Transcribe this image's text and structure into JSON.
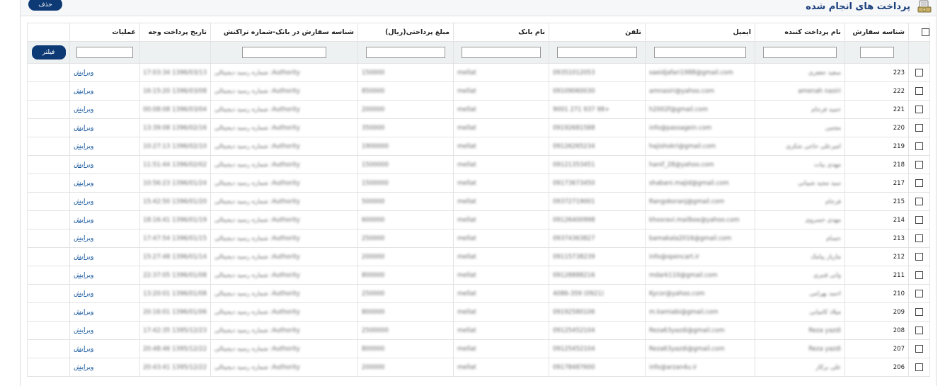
{
  "header": {
    "title": "پرداخت های انجام شده",
    "delete_label": "حذف"
  },
  "columns": {
    "id": "شناسه سفارش",
    "payer": "نام پرداخت کننده",
    "email": "ایمیل",
    "tel": "تلفن",
    "bank": "نام بانک",
    "amount": "مبلغ پرداختی(ریال)",
    "order": "شناسه سفارش در بانک-شماره تراکنش",
    "date": "تاریخ پرداخت وجه",
    "ops": "عملیات"
  },
  "filter": {
    "button_label": "فیلتر"
  },
  "rows": [
    {
      "id": "223",
      "payer": "سعید جعفری",
      "email": "saeidjafari1988@gmail.com",
      "tel": "09351012053",
      "bank": "mellat",
      "amount": "150000",
      "order": "Authority: شماره رسید دیجیتالی",
      "date": "1396/03/13 17:03:34",
      "op": "ویرایش"
    },
    {
      "id": "222",
      "payer": "amenah nasiri",
      "email": "amnasiri@yahoo.com",
      "tel": "09109060030",
      "bank": "mellat",
      "amount": "850000",
      "order": "Authority: شماره رسید دیجیتالی",
      "date": "1396/03/08 16:15:20",
      "op": "ویرایش"
    },
    {
      "id": "221",
      "payer": "حمید فرجام",
      "email": "h2002f@gmail.com",
      "tel": "+98 937 271 9001",
      "bank": "mellat",
      "amount": "200000",
      "order": "Authority: شماره رسید دیجیتالی",
      "date": "1396/03/04 00:08:08",
      "op": "ویرایش"
    },
    {
      "id": "220",
      "payer": "مجتبی",
      "email": "info@passagein.com",
      "tel": "09192681588",
      "bank": "mellat",
      "amount": "350000",
      "order": "Authority: شماره رسید دیجیتالی",
      "date": "1396/02/16 13:39:08",
      "op": "ویرایش"
    },
    {
      "id": "219",
      "payer": "امیرعلی حاجی شکری",
      "email": "hajishokri@gmail.com",
      "tel": "09126265234",
      "bank": "mellat",
      "amount": "1900000",
      "order": "Authority: شماره رسید دیجیتالی",
      "date": "1396/02/10 10:27:13",
      "op": "ویرایش"
    },
    {
      "id": "218",
      "payer": "مهدی بیات",
      "email": "hanif_28@yahoo.com",
      "tel": "09121353451",
      "bank": "mellat",
      "amount": "1500000",
      "order": "Authority: شماره رسید دیجیتالی",
      "date": "1396/02/02 11:51:44",
      "op": "ویرایش"
    },
    {
      "id": "217",
      "payer": "سید مجید شیبانی",
      "email": "shabani.majid@gmail.com",
      "tel": "09173673450",
      "bank": "mellat",
      "amount": "1500000",
      "order": "Authority: شماره رسید دیجیتالی",
      "date": "1396/01/24 10:56:23",
      "op": "ویرایش"
    },
    {
      "id": "215",
      "payer": "فرجام",
      "email": "Rangokoranj@gmail.com",
      "tel": "09372719001",
      "bank": "mellat",
      "amount": "500000",
      "order": "Authority: شماره رسید دیجیتالی",
      "date": "1396/01/20 15:42:50",
      "op": "ویرایش"
    },
    {
      "id": "214",
      "payer": "مهدی خسروی",
      "email": "khosravi.mailbox@yahoo.com",
      "tel": "09126400998",
      "bank": "mellat",
      "amount": "600000",
      "order": "Authority: شماره رسید دیجیتالی",
      "date": "1396/01/19 18:16:41",
      "op": "ویرایش"
    },
    {
      "id": "213",
      "payer": "حسام",
      "email": "bamakala2016@gmail.com",
      "tel": "09374363827",
      "bank": "mellat",
      "amount": "250000",
      "order": "Authority: شماره رسید دیجیتالی",
      "date": "1396/01/15 17:47:54",
      "op": "ویرایش"
    },
    {
      "id": "212",
      "payer": "مازیار پیامک",
      "email": "info@opencart.ir",
      "tel": "09115738239",
      "bank": "mellat",
      "amount": "200000",
      "order": "Authority: شماره رسید دیجیتالی",
      "date": "1396/01/14 15:27:48",
      "op": "ویرایش"
    },
    {
      "id": "211",
      "payer": "وانی قنبری",
      "email": "mdark110@gmail.com",
      "tel": "09128888216",
      "bank": "mellat",
      "amount": "800000",
      "order": "Authority: شماره رسید دیجیتالی",
      "date": "1396/01/08 22:37:05",
      "op": "ویرایش"
    },
    {
      "id": "210",
      "payer": "احمد بهرامی",
      "email": "Kycor@yahoo.com",
      "tel": "(0921) 4086-359",
      "bank": "mellat",
      "amount": "250000",
      "order": "Authority: شماره رسید دیجیتالی",
      "date": "1396/01/08 13:20:01",
      "op": "ویرایش"
    },
    {
      "id": "209",
      "payer": "میلاد کامیابی",
      "email": "m.kamiabi@gmail.com",
      "tel": "09192580106",
      "bank": "mellat",
      "amount": "800000",
      "order": "Authority: شماره رسید دیجیتالی",
      "date": "1396/01/06 20:16:01",
      "op": "ویرایش"
    },
    {
      "id": "208",
      "payer": "Reza yazdi",
      "email": "Reza63yazdi@gmail.com",
      "tel": "09125452104",
      "bank": "mellat",
      "amount": "2500000",
      "order": "Authority: شماره رسید دیجیتالی",
      "date": "1395/12/23 17:42:35",
      "op": "ویرایش"
    },
    {
      "id": "207",
      "payer": "Reza yazdi",
      "email": "Reza63yazdi@gmail.com",
      "tel": "09125452104",
      "bank": "mellat",
      "amount": "800000",
      "order": "Authority: شماره رسید دیجیتالی",
      "date": "1395/12/22 20:48:46",
      "op": "ویرایش"
    },
    {
      "id": "206",
      "payer": "علی برکاز",
      "email": "info@arzan4u.ir",
      "tel": "09178487600",
      "bank": "mellat",
      "amount": "200000",
      "order": "Authority: شماره رسید دیجیتالی",
      "date": "1395/12/22 20:43:41",
      "op": "ویرایش"
    }
  ]
}
